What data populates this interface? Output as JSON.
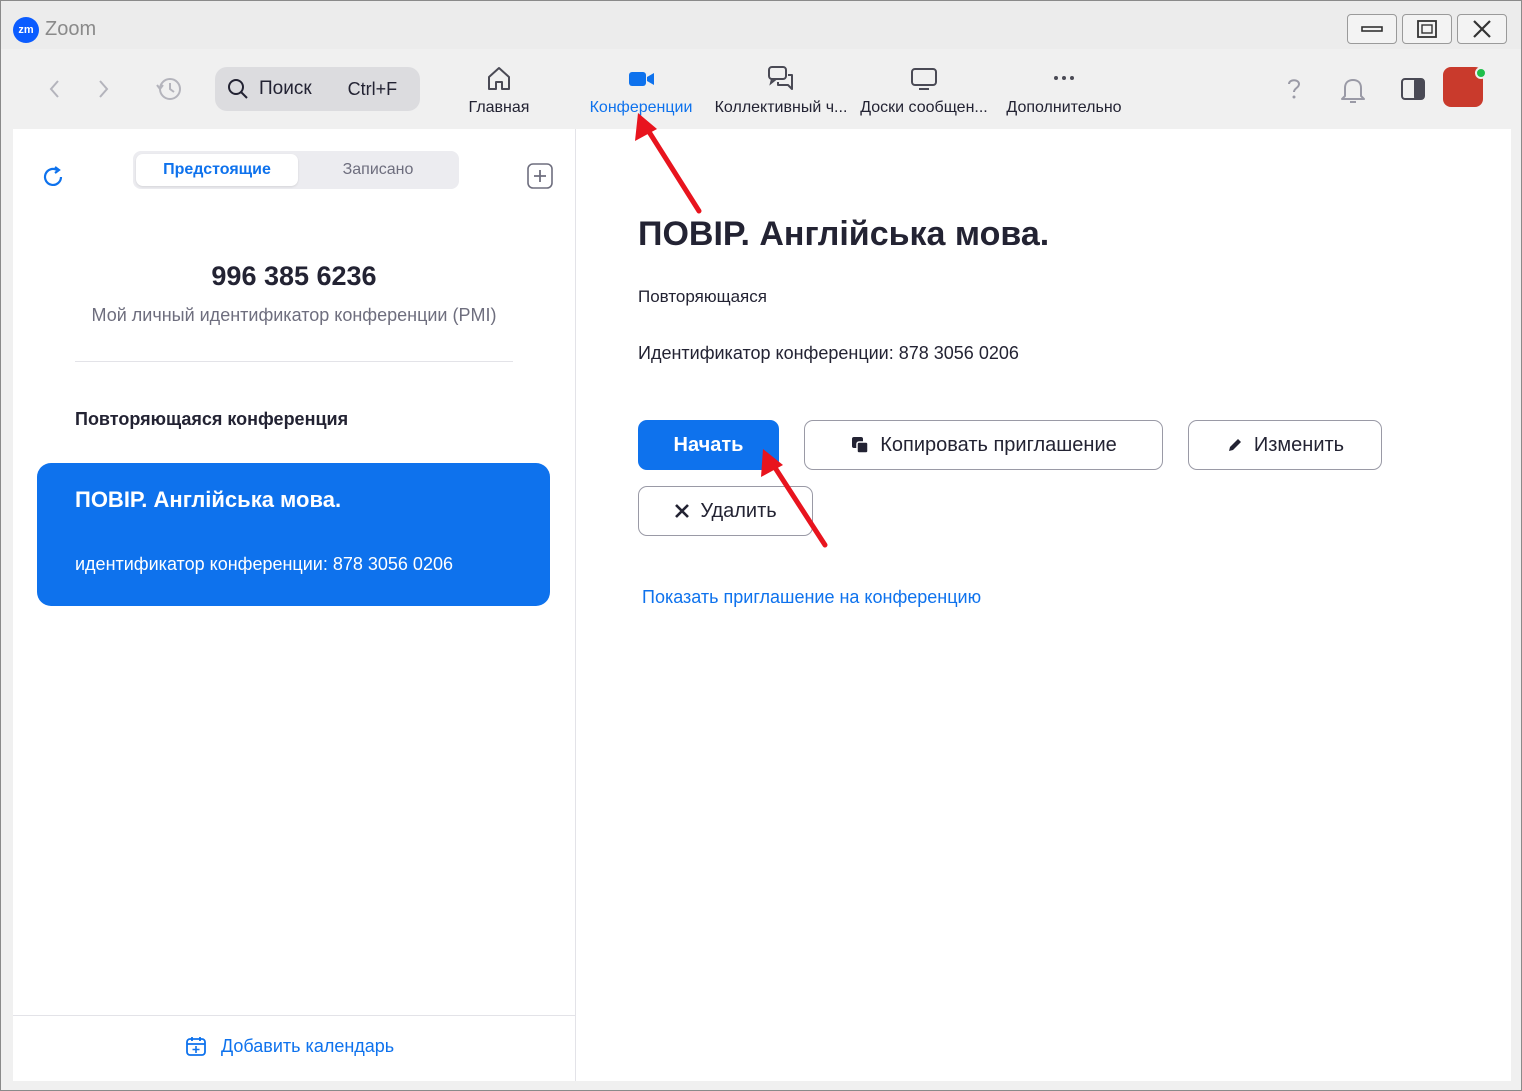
{
  "window": {
    "app_logo": "zm",
    "title": "Zoom",
    "controls": [
      "minimize-icon",
      "maximize-icon",
      "close-icon"
    ]
  },
  "toolbar": {
    "back_icon": "chevron-left-icon",
    "forward_icon": "chevron-right-icon",
    "history_icon": "clock-history-icon",
    "search": {
      "label": "Поиск",
      "shortcut": "Ctrl+F",
      "icon": "search-icon"
    },
    "tabs": [
      {
        "label": "Главная",
        "icon": "home-icon",
        "active": false
      },
      {
        "label": "Конференции",
        "icon": "video-camera-icon",
        "active": true
      },
      {
        "label": "Коллективный ч...",
        "icon": "chat-bubbles-icon",
        "active": false
      },
      {
        "label": "Доски сообщен...",
        "icon": "whiteboard-icon",
        "active": false
      },
      {
        "label": "Дополнительно",
        "icon": "more-dots-icon",
        "active": false
      }
    ],
    "right_icons": [
      "help-icon",
      "bell-icon",
      "side-panel-icon"
    ],
    "accent_color": "#0e72ed"
  },
  "left": {
    "segments": {
      "upcoming": "Предстоящие",
      "recorded": "Записано"
    },
    "pmi_number": "996 385 6236",
    "pmi_label": "Мой личный идентификатор конференции (PMI)",
    "section_title": "Повторяющаяся конференция",
    "meeting_card": {
      "title": "ПОВІР. Англійська мова.",
      "id_line": "идентификатор конференции: 878 3056 0206"
    },
    "add_calendar": "Добавить календарь"
  },
  "detail": {
    "title": "ПОВІР. Англійська мова.",
    "recurrence": "Повторяющаяся",
    "meeting_id_line": "Идентификатор конференции: 878 3056 0206",
    "start_label": "Начать",
    "copy_invite_label": "Копировать приглашение",
    "edit_label": "Изменить",
    "delete_label": "Удалить",
    "show_invite_label": "Показать приглашение на конференцию"
  }
}
